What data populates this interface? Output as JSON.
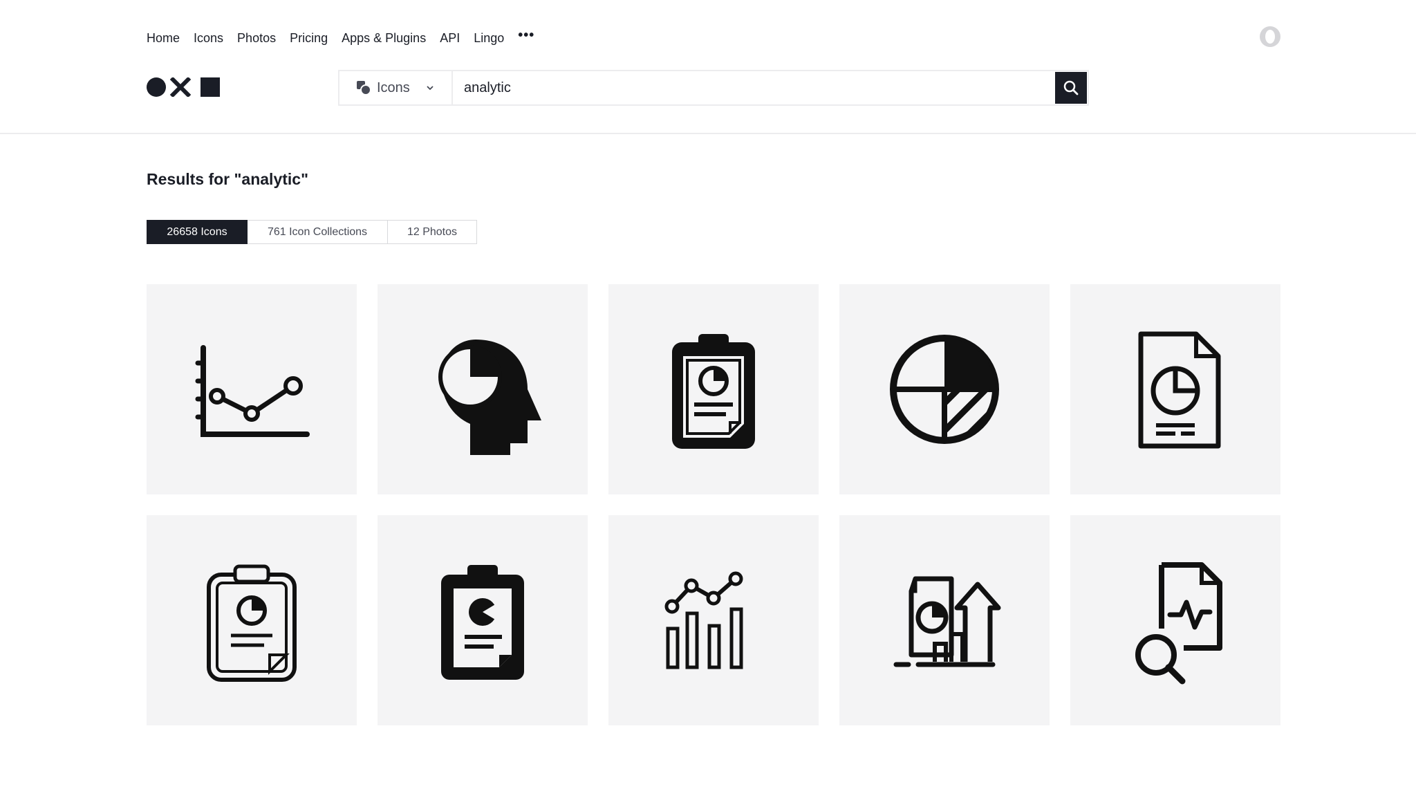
{
  "nav": {
    "items": [
      "Home",
      "Icons",
      "Photos",
      "Pricing",
      "Apps & Plugins",
      "API",
      "Lingo"
    ],
    "more": "•••"
  },
  "search": {
    "type_label": "Icons",
    "query": "analytic"
  },
  "results": {
    "title": "Results for \"analytic\"",
    "tabs": [
      "26658 Icons",
      "761 Icon Collections",
      "12 Photos"
    ]
  },
  "icons": [
    "line-chart-icon",
    "head-pie-chart-icon",
    "clipboard-pie-report-filled-icon",
    "pie-chart-hatched-icon",
    "document-pie-chart-icon",
    "clipboard-pie-report-outline-icon",
    "clipboard-pie-report-solid-icon",
    "bar-line-chart-icon",
    "report-growth-arrow-icon",
    "document-search-pulse-icon"
  ],
  "colors": {
    "text": "#1a1d26",
    "tile_bg": "#f4f4f5",
    "active_tab_bg": "#1a1d26"
  }
}
